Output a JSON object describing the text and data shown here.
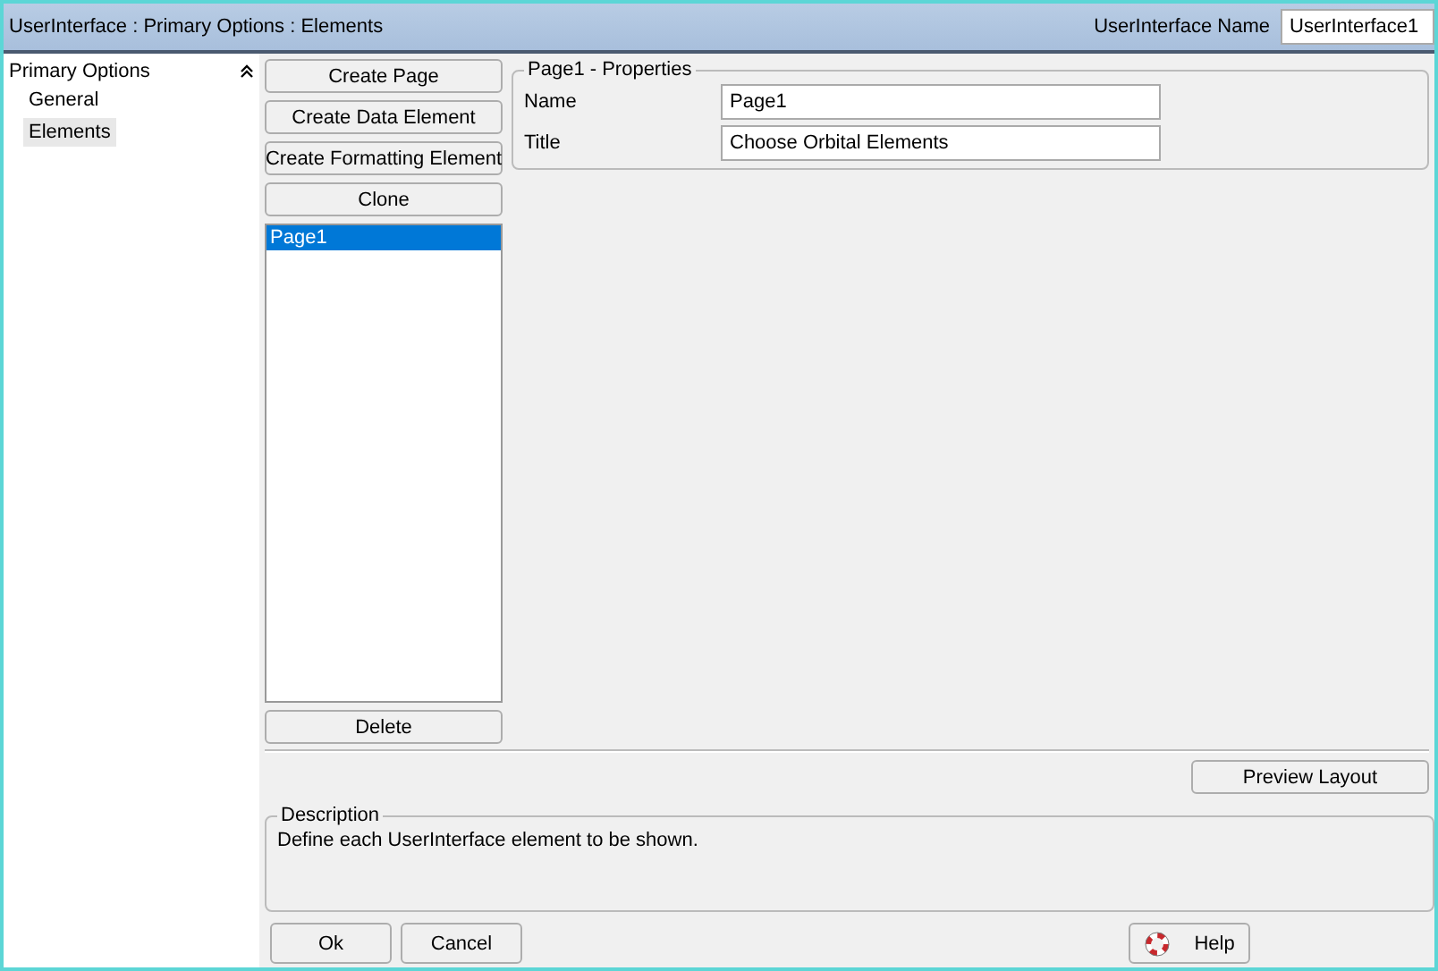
{
  "window": {
    "title": "UserInterface : Primary Options : Elements"
  },
  "name_field": {
    "label": "UserInterface Name",
    "value": "UserInterface1"
  },
  "sidebar": {
    "heading": "Primary Options",
    "expanded": true,
    "items": [
      {
        "label": "General",
        "selected": false
      },
      {
        "label": "Elements",
        "selected": true
      }
    ]
  },
  "element_buttons": [
    "Create Page",
    "Create Data Element",
    "Create Formatting Element",
    "Clone"
  ],
  "element_list": [
    {
      "label": "Page1",
      "selected": true
    }
  ],
  "delete_button": "Delete",
  "properties": {
    "title": "Page1 - Properties",
    "fields": [
      {
        "label": "Name",
        "value": "Page1"
      },
      {
        "label": "Title",
        "value": "Choose Orbital Elements"
      }
    ]
  },
  "preview_button": "Preview Layout",
  "description": {
    "title": "Description",
    "text": "Define each UserInterface element to be shown."
  },
  "footer": {
    "ok": "Ok",
    "cancel": "Cancel",
    "help": "Help"
  }
}
